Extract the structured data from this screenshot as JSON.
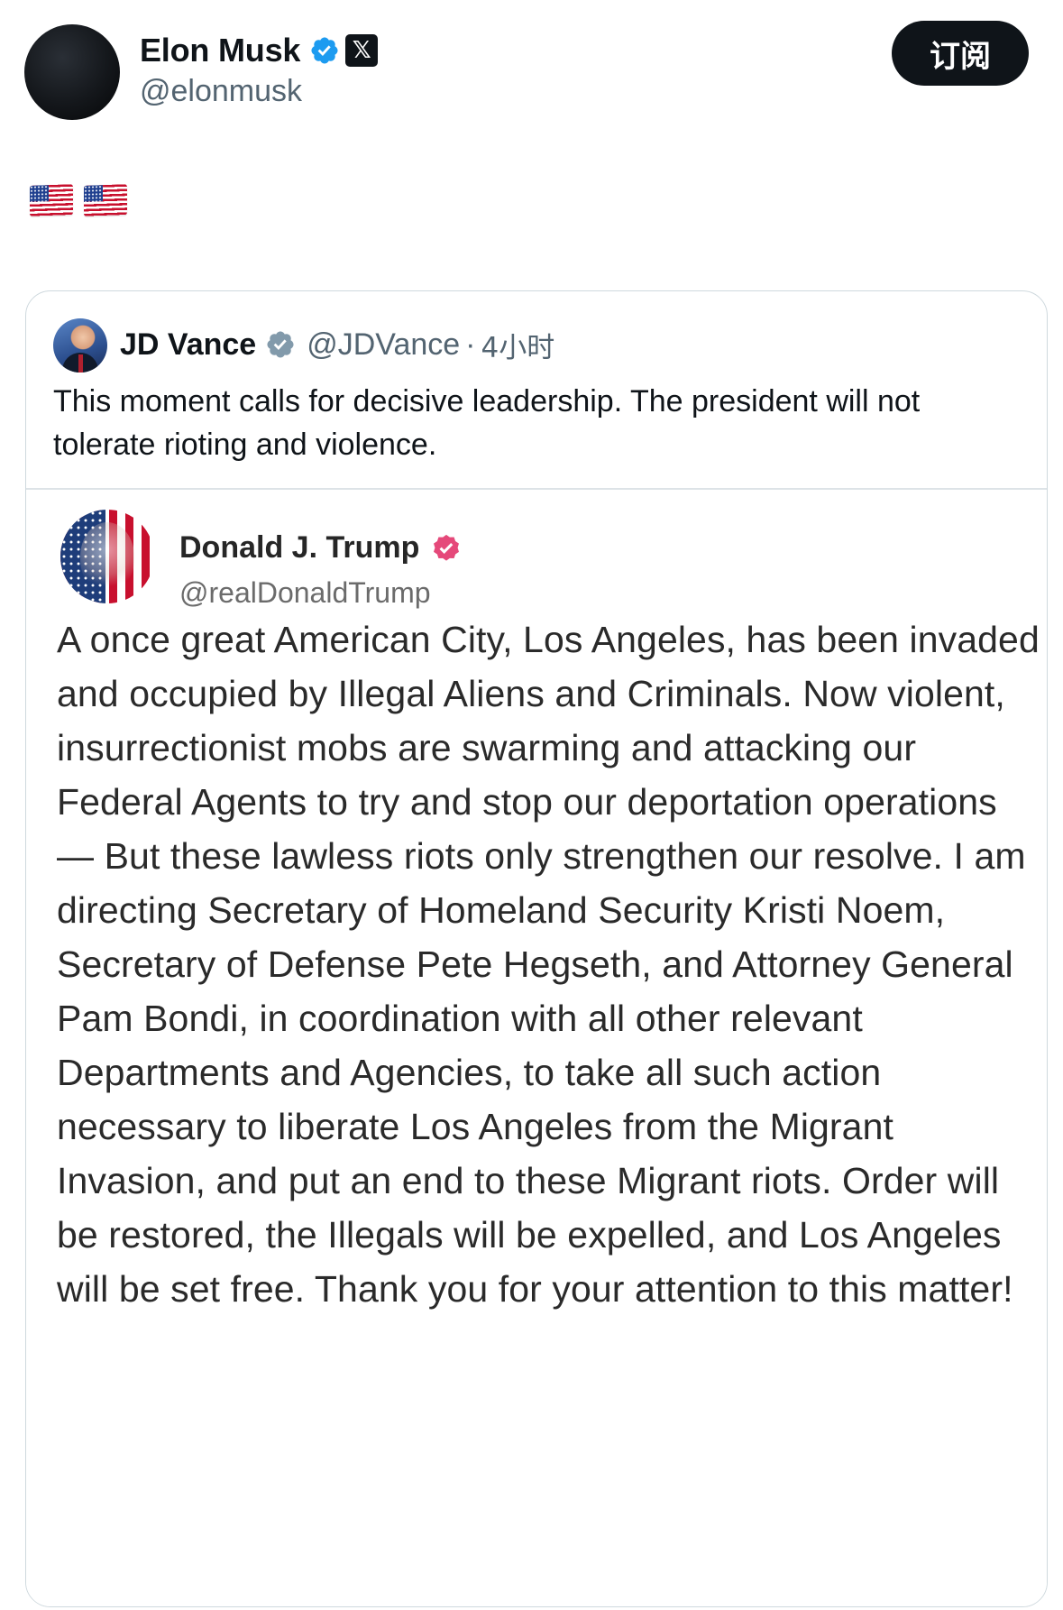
{
  "author": {
    "display_name": "Elon Musk",
    "handle": "@elonmusk",
    "verified_icon": "verified-badge-icon",
    "affiliate_icon": "x-logo-icon",
    "x_logo_glyph": "𝕏"
  },
  "actions": {
    "subscribe_label": "订阅"
  },
  "post": {
    "emoji": [
      "us-flag-icon",
      "us-flag-icon"
    ]
  },
  "quoted_post": {
    "display_name": "JD Vance",
    "handle": "@JDVance",
    "separator": "·",
    "time": "4小时",
    "text": "This moment calls for decisive leadership. The president will not tolerate rioting and violence.",
    "verified_icon": "gray-verified-badge-icon"
  },
  "embedded_post": {
    "display_name": "Donald J. Trump",
    "handle": "@realDonaldTrump",
    "verified_icon": "pink-verified-badge-icon",
    "body": "A once great American City, Los Angeles, has been invaded and occupied by Illegal Aliens and Criminals.  Now violent, insurrectionist mobs are swarming and attacking our Federal Agents to try and stop our deportation operations — But these lawless riots only strengthen our resolve. I am directing Secretary of Homeland Security Kristi Noem, Secretary of Defense Pete Hegseth, and Attorney General Pam Bondi, in coordination with all other relevant Departments and Agencies, to take all such action necessary to liberate Los Angeles from the Migrant Invasion, and put an end to these Migrant riots. Order will be restored, the Illegals will be expelled, and Los Angeles will be set free. Thank you for your attention to this matter!"
  },
  "colors": {
    "primary_text": "#0f1419",
    "secondary_text": "#536471",
    "x_blue_verified": "#1d9bf0",
    "gray_verified": "#829aab",
    "truth_pink_verified": "#e5497a",
    "button_bg": "#0f1419",
    "card_border": "#cfd9de"
  }
}
